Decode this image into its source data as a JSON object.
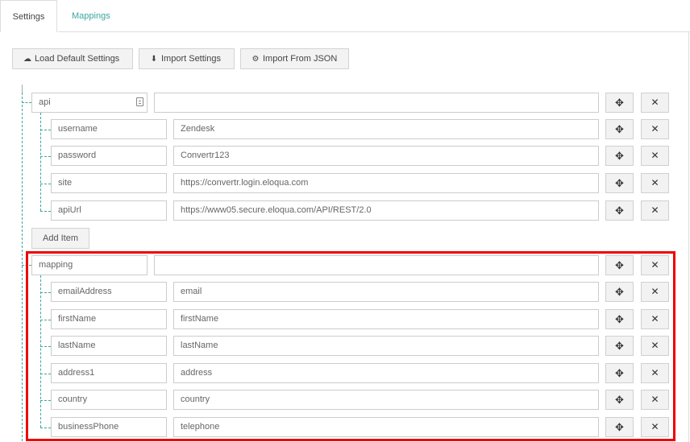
{
  "tabs": [
    {
      "label": "Settings",
      "active": true
    },
    {
      "label": "Mappings",
      "active": false
    }
  ],
  "toolbar": {
    "load_default": "Load Default Settings",
    "import_settings": "Import Settings",
    "import_json": "Import From JSON"
  },
  "icons": {
    "move": "✥",
    "remove": "✕",
    "cloud": "☁",
    "download": "⬇",
    "gears": "⚙"
  },
  "groups": {
    "api": {
      "key": "api",
      "value": "",
      "rows": [
        {
          "key": "username",
          "value": "Zendesk"
        },
        {
          "key": "password",
          "value": "Convertr123"
        },
        {
          "key": "site",
          "value": "https://convertr.login.eloqua.com"
        },
        {
          "key": "apiUrl",
          "value": "https://www05.secure.eloqua.com/API/REST/2.0"
        }
      ]
    },
    "mapping": {
      "key": "mapping",
      "value": "",
      "rows": [
        {
          "key": "emailAddress",
          "value": "email"
        },
        {
          "key": "firstName",
          "value": "firstName"
        },
        {
          "key": "lastName",
          "value": "lastName"
        },
        {
          "key": "address1",
          "value": "address"
        },
        {
          "key": "country",
          "value": "country"
        },
        {
          "key": "businessPhone",
          "value": "telephone"
        }
      ]
    }
  },
  "add_item_label": "Add Item",
  "colors": {
    "accent": "#3aa6a0",
    "highlight": "#ee0000"
  }
}
